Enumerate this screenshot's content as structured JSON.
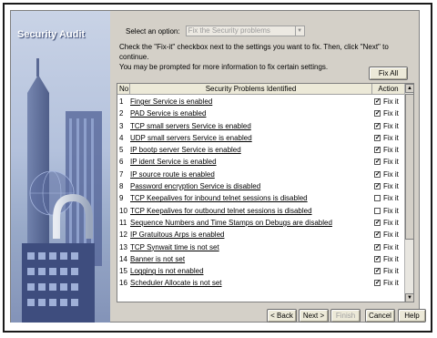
{
  "banner": {
    "title": "Security Audit"
  },
  "option": {
    "label": "Select an option:",
    "selected": "Fix the Security problems"
  },
  "instructions": [
    "Check the \"Fix-it\" checkbox next to the settings you want to fix. Then, click \"Next\" to continue.",
    "You may be prompted for more information to fix certain settings."
  ],
  "buttons": {
    "fix_all": "Fix All",
    "back": "< Back",
    "next": "Next >",
    "finish": "Finish",
    "cancel": "Cancel",
    "help": "Help"
  },
  "table": {
    "columns": {
      "no": "No",
      "problem": "Security Problems Identified",
      "action": "Action"
    },
    "action_label": "Fix it",
    "rows": [
      {
        "no": "1",
        "problem": "Finger Service is enabled",
        "checked": true
      },
      {
        "no": "2",
        "problem": "PAD Service is enabled",
        "checked": true
      },
      {
        "no": "3",
        "problem": "TCP small servers Service is enabled",
        "checked": true
      },
      {
        "no": "4",
        "problem": "UDP small servers Service is enabled",
        "checked": true
      },
      {
        "no": "5",
        "problem": "IP bootp server Service is enabled",
        "checked": true
      },
      {
        "no": "6",
        "problem": "IP ident Service is enabled",
        "checked": true
      },
      {
        "no": "7",
        "problem": "IP source route is enabled",
        "checked": true
      },
      {
        "no": "8",
        "problem": "Password encryption Service is disabled",
        "checked": true
      },
      {
        "no": "9",
        "problem": "TCP Keepalives for inbound telnet sessions is disabled",
        "checked": false
      },
      {
        "no": "10",
        "problem": "TCP Keepalives for outbound telnet sessions is disabled",
        "checked": false
      },
      {
        "no": "11",
        "problem": "Sequence Numbers and Time Stamps on Debugs are disabled",
        "checked": true
      },
      {
        "no": "12",
        "problem": "IP Gratuitous Arps is enabled",
        "checked": true
      },
      {
        "no": "13",
        "problem": "TCP Synwait time is not set",
        "checked": true
      },
      {
        "no": "14",
        "problem": "Banner is not set",
        "checked": true
      },
      {
        "no": "15",
        "problem": "Logging is not enabled",
        "checked": true
      },
      {
        "no": "16",
        "problem": "Scheduler Allocate is not set",
        "checked": true
      }
    ]
  }
}
